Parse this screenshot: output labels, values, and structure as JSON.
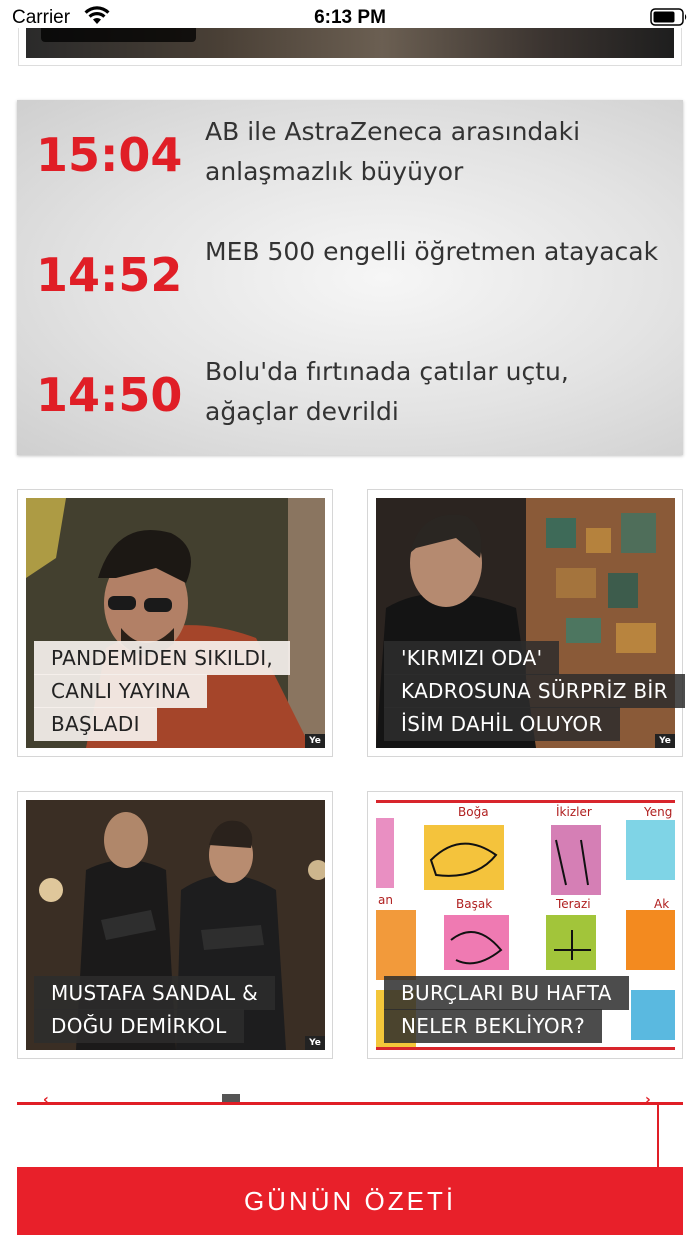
{
  "status_bar": {
    "carrier": "Carrier",
    "time": "6:13 PM"
  },
  "breaking_news": [
    {
      "time": "15:04",
      "headline": "AB ile AstraZeneca arasındaki anlaşmazlık büyüyor"
    },
    {
      "time": "14:52",
      "headline": "MEB 500 engelli öğretmen atayacak"
    },
    {
      "time": "14:50",
      "headline": "Bolu'da fırtınada çatılar uçtu, ağaçlar devrildi"
    }
  ],
  "cards": [
    {
      "caption_lines": [
        "PANDEMİDEN SIKILDI,",
        "CANLI YAYINA",
        "BAŞLADI"
      ],
      "tag": "Ye"
    },
    {
      "caption_lines": [
        "'KIRMIZI ODA'",
        "KADROSUNA SÜRPRİZ BİR",
        "İSİM DAHİL OLUYOR"
      ],
      "tag": "Ye"
    },
    {
      "caption_lines": [
        "MUSTAFA SANDAL &",
        "DOĞU DEMİRKOL"
      ],
      "tag": "Ye"
    },
    {
      "caption_lines": [
        "BURÇLARI BU HAFTA",
        "NELER BEKLİYOR?"
      ]
    }
  ],
  "zodiac_labels": [
    "Boğa",
    "İkizler",
    "Yeng",
    "an",
    "Başak",
    "Terazi",
    "Ak"
  ],
  "summary_button": "GÜNÜN ÖZETİ",
  "colors": {
    "accent_red": "#e01e26",
    "button_red": "#e8202a"
  }
}
